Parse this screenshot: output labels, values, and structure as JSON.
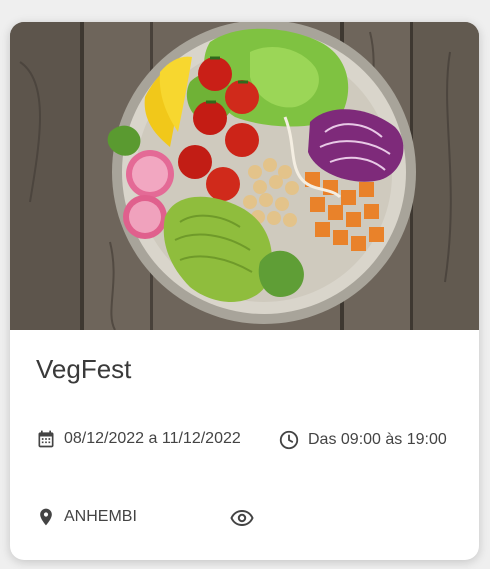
{
  "event": {
    "title": "VegFest",
    "date_range": "08/12/2022 a 11/12/2022",
    "time_range": "Das 09:00 às 19:00",
    "location": "ANHEMBI"
  },
  "icons": {
    "date": "calendar-icon",
    "time": "clock-icon",
    "location": "map-pin-icon",
    "view": "eye-icon"
  },
  "colors": {
    "text": "#3a3a3a",
    "icon": "#444444",
    "card": "#ffffff",
    "background": "#efefef"
  }
}
